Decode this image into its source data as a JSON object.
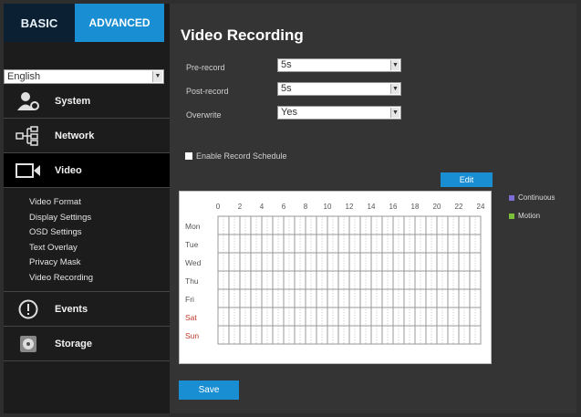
{
  "tabs": {
    "basic": "BASIC",
    "advanced": "ADVANCED"
  },
  "language": {
    "selected": "English"
  },
  "nav": {
    "system": "System",
    "network": "Network",
    "video": "Video",
    "video_sub": [
      "Video Format",
      "Display Settings",
      "OSD Settings",
      "Text Overlay",
      "Privacy Mask",
      "Video Recording"
    ],
    "events": "Events",
    "storage": "Storage"
  },
  "page": {
    "title": "Video Recording",
    "pre_record_label": "Pre-record",
    "pre_record_value": "5s",
    "post_record_label": "Post-record",
    "post_record_value": "5s",
    "overwrite_label": "Overwrite",
    "overwrite_value": "Yes",
    "enable_schedule_label": "Enable Record Schedule",
    "edit_button": "Edit",
    "save_button": "Save"
  },
  "schedule": {
    "hours": [
      "0",
      "2",
      "4",
      "6",
      "8",
      "10",
      "12",
      "14",
      "16",
      "18",
      "20",
      "22",
      "24"
    ],
    "days": [
      "Mon",
      "Tue",
      "Wed",
      "Thu",
      "Fri",
      "Sat",
      "Sun"
    ],
    "weekend_color": "#c0392b",
    "weekday_color": "#555555"
  },
  "legend": {
    "continuous_label": "Continuous",
    "continuous_color": "#7b6fd6",
    "motion_label": "Motion",
    "motion_color": "#7cbf3a"
  },
  "colors": {
    "accent": "#1a8ed2",
    "tab_dark": "#0b2133"
  }
}
